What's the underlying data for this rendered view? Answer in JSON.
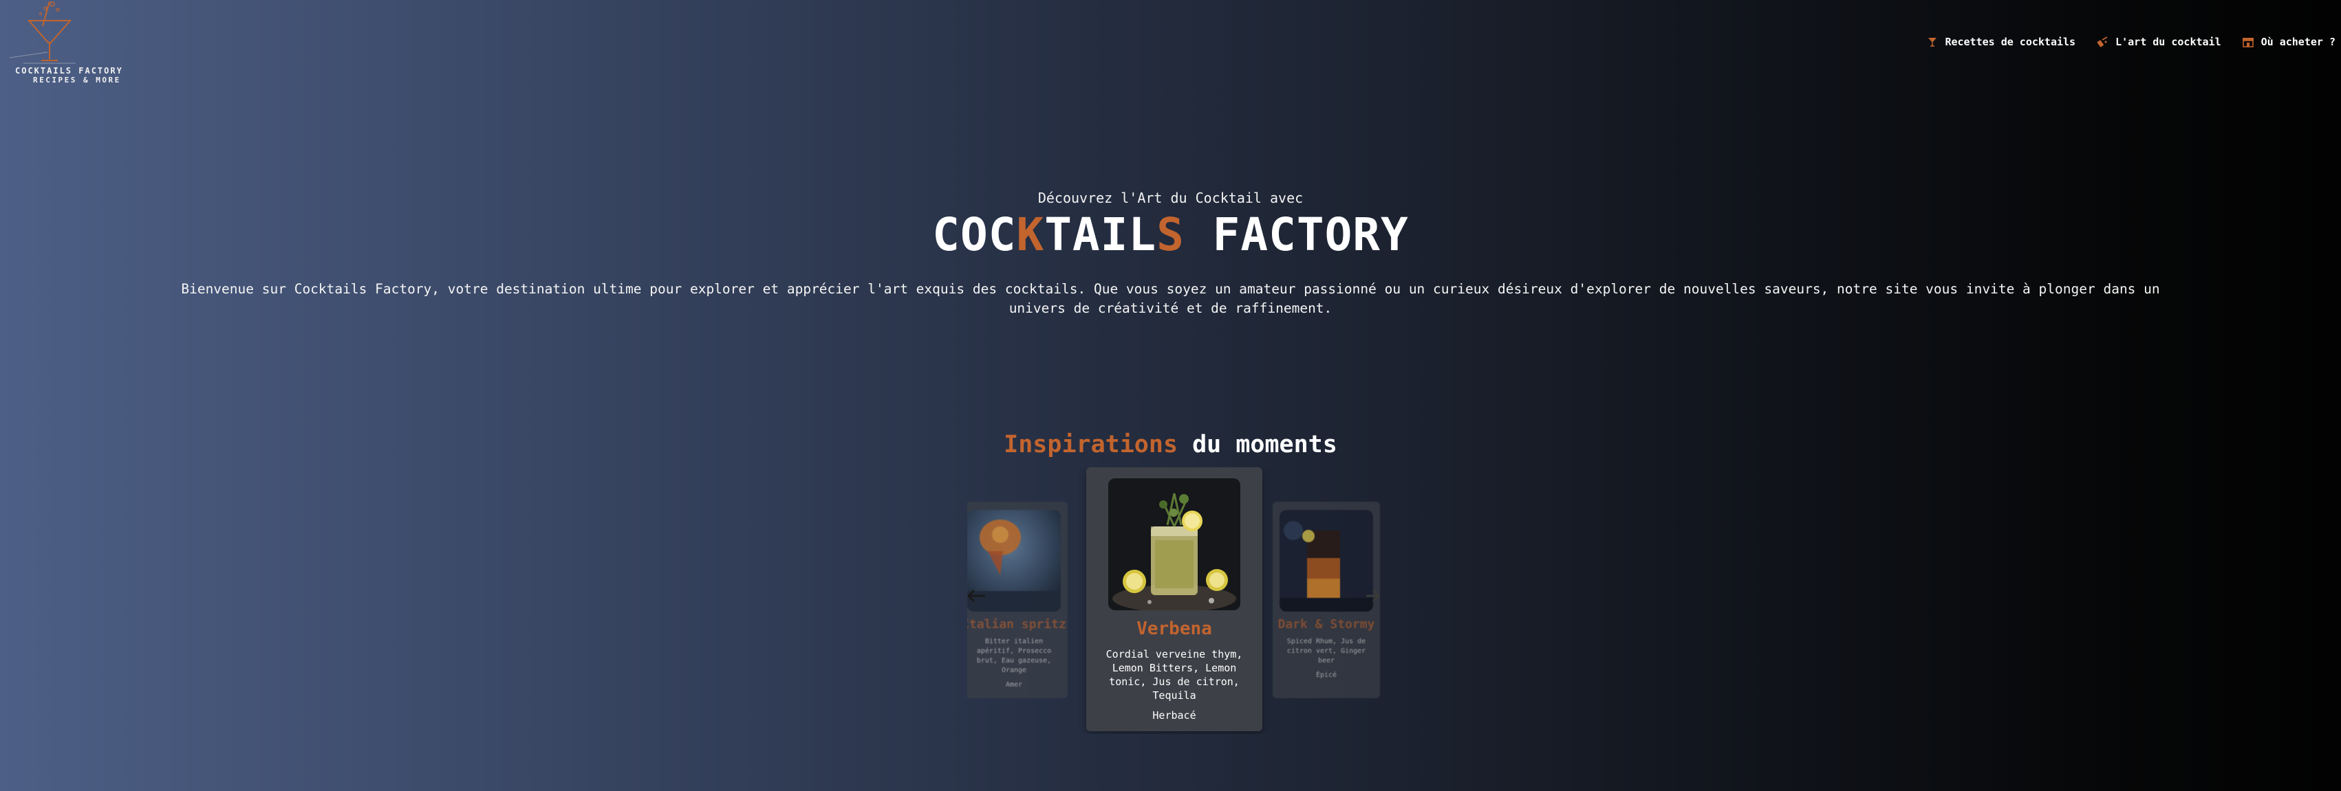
{
  "logo": {
    "line1": "COCKTAILS FACTORY",
    "line2": "RECIPES & MORE",
    "icon": "cocktail-glass-logo"
  },
  "nav": [
    {
      "label": "Recettes de cocktails",
      "icon": "cocktail-icon"
    },
    {
      "label": "L'art du cocktail",
      "icon": "shaker-icon"
    },
    {
      "label": "Où acheter ?",
      "icon": "shop-icon"
    }
  ],
  "hero": {
    "subtitle": "Découvrez l'Art du Cocktail avec",
    "title_parts": [
      "COC",
      "K",
      "TAIL",
      "S",
      " FACTORY"
    ],
    "description": "Bienvenue sur Cocktails Factory, votre destination ultime pour explorer et apprécier l'art exquis des cocktails. Que vous soyez un amateur passionné ou un curieux désireux d'explorer de nouvelles saveurs, notre site vous invite à plonger dans un univers de créativité et de raffinement."
  },
  "inspirations": {
    "title_accent": "Inspirations",
    "title_rest": " du moments"
  },
  "carousel": {
    "prev_icon": "arrow-left-icon",
    "next_icon": "arrow-right-icon",
    "cards": {
      "left": {
        "name": "Italian spritz",
        "ingredients": "Bitter italien apéritif, Prosecco brut, Eau gazeuse, Orange",
        "tag": "Amer"
      },
      "center": {
        "name": "Verbena",
        "ingredients": "Cordial verveine thym, Lemon Bitters, Lemon tonic, Jus de citron, Tequila",
        "tag": "Herbacé"
      },
      "right": {
        "name": "Dark & Stormy",
        "ingredients": "Spiced Rhum, Jus de citron vert, Ginger beer",
        "tag": "Épicé"
      }
    }
  },
  "colors": {
    "accent": "#c2642e",
    "background_left": "#4d5f86",
    "background_right": "#020202"
  }
}
